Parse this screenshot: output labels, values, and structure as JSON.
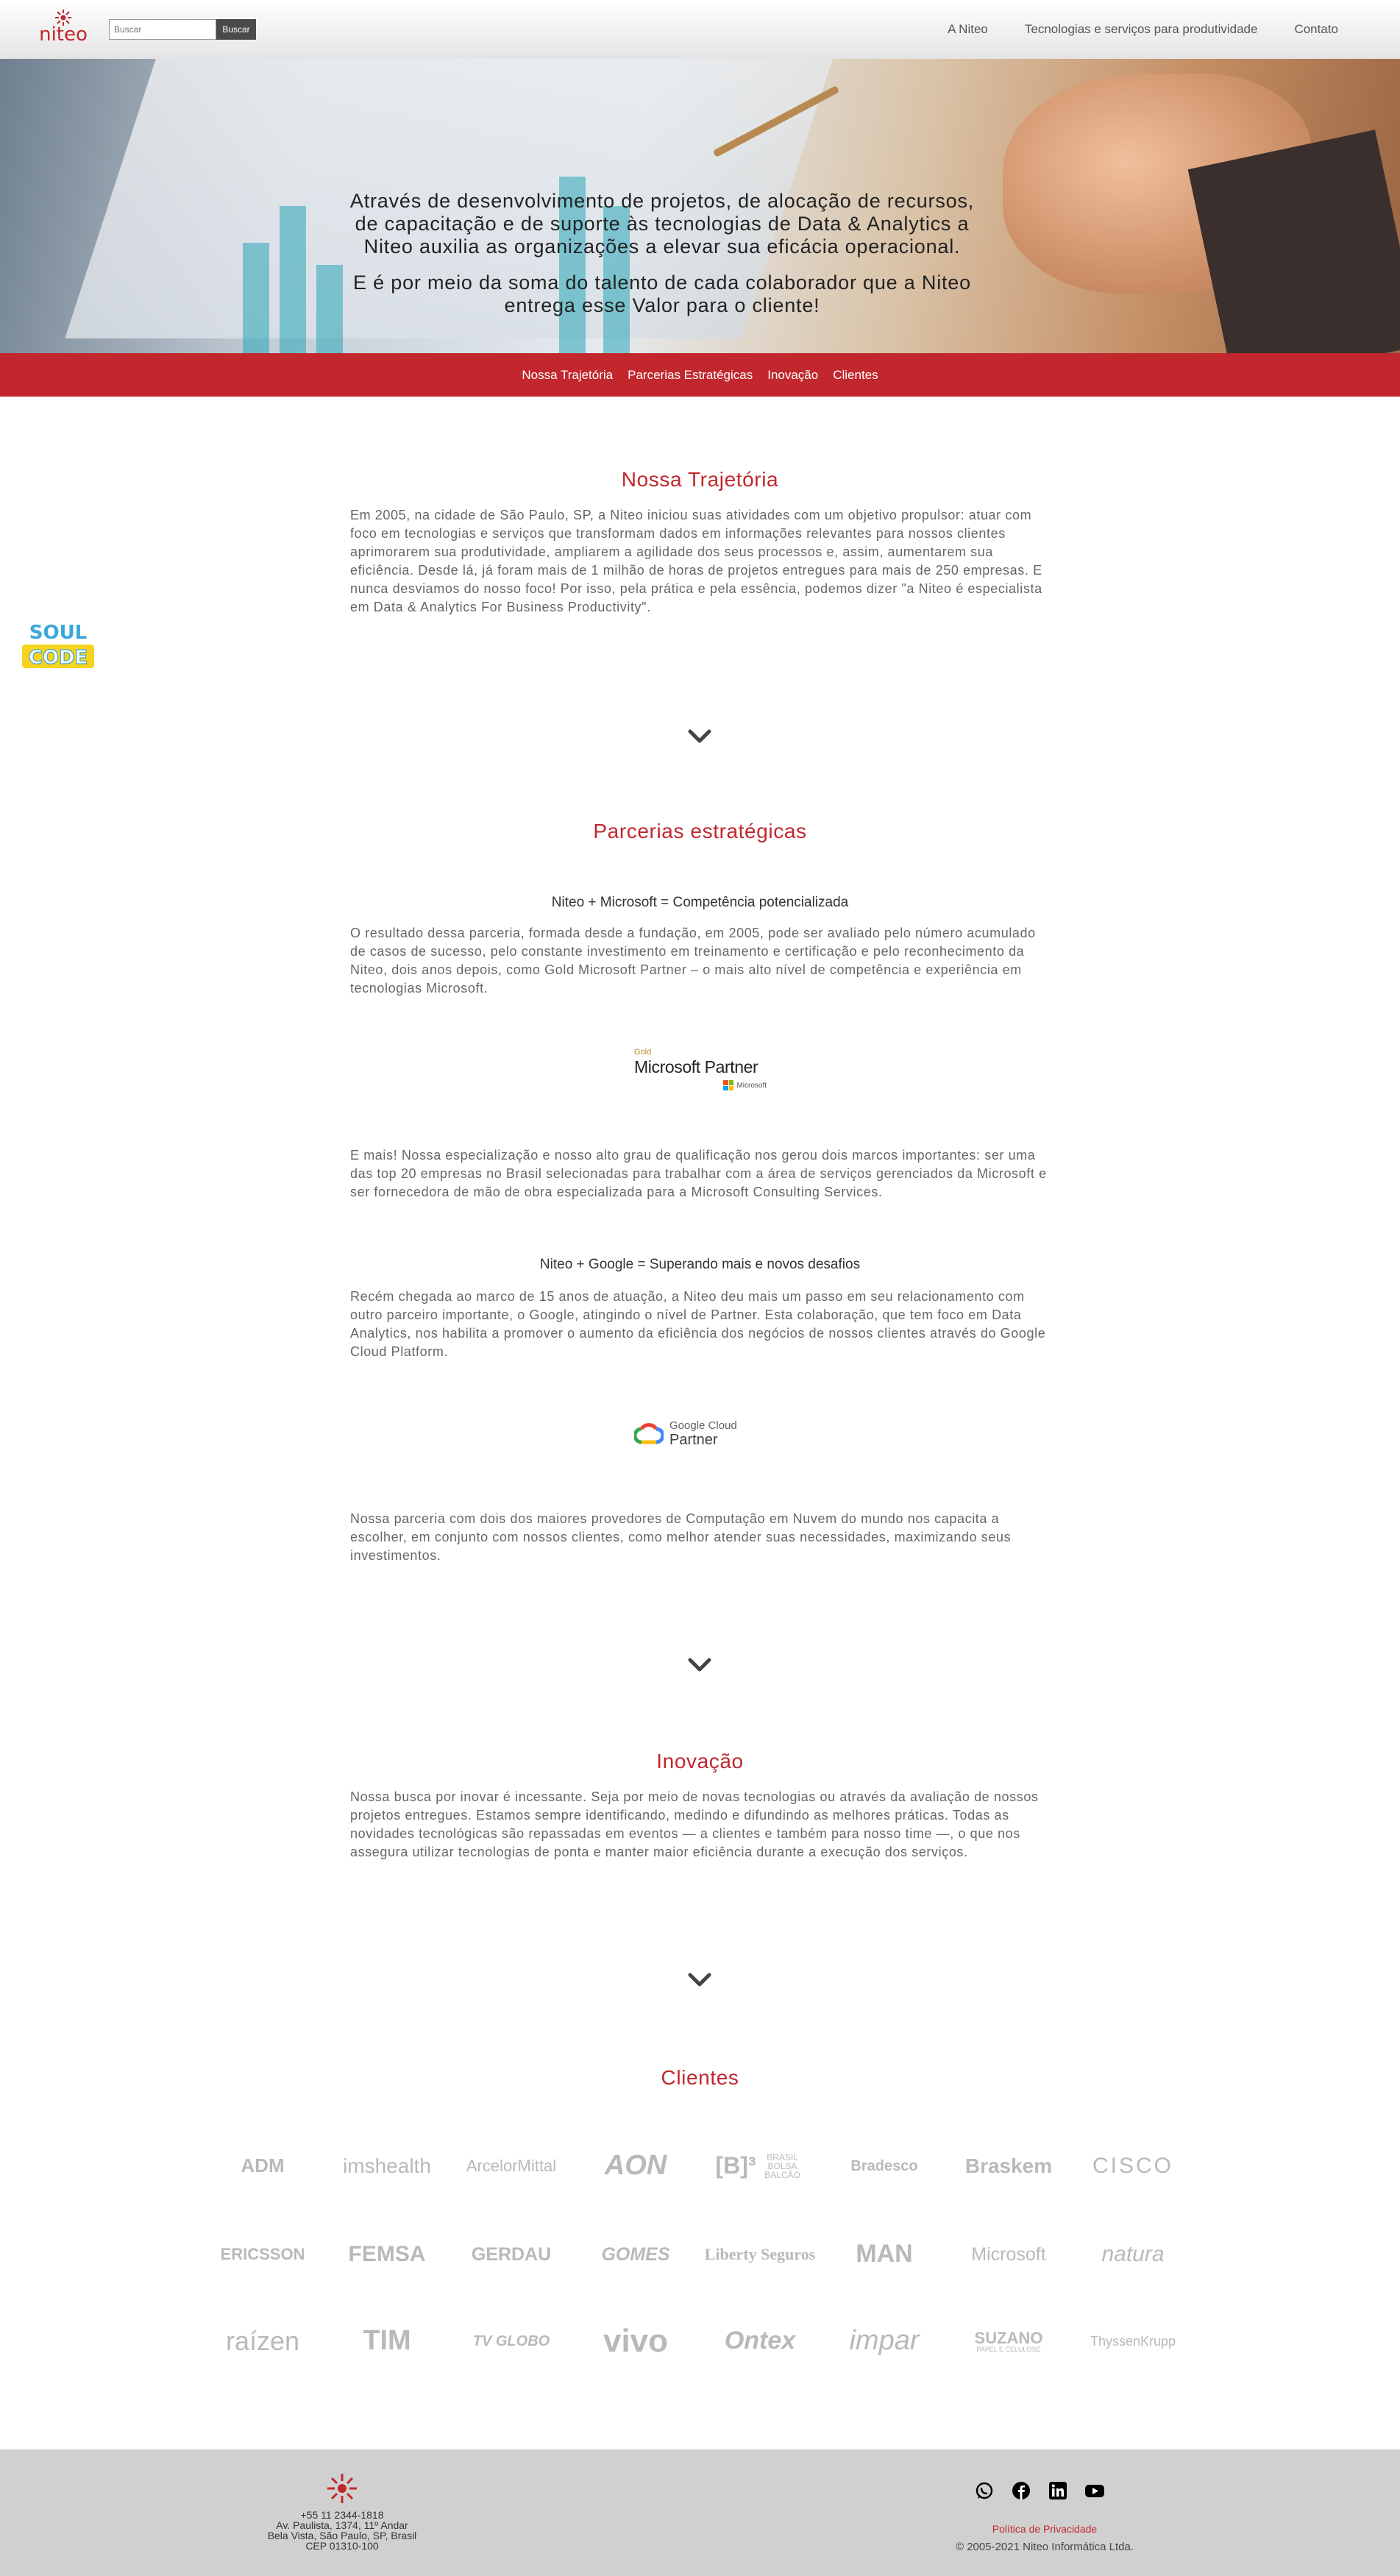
{
  "header": {
    "brand": "niteo",
    "search_placeholder": "Buscar",
    "search_button": "Buscar",
    "nav": [
      "A Niteo",
      "Tecnologias e serviços para produtividade",
      "Contato"
    ]
  },
  "hero": {
    "paragraph1": "Através de desenvolvimento de projetos, de alocação de recursos, de capacitação e de suporte às tecnologias de Data & Analytics a Niteo auxilia as organizações a elevar sua eficácia operacional.",
    "paragraph2": "E é por meio da soma do talento de cada colaborador que a Niteo entrega esse Valor para o cliente!"
  },
  "subnav": [
    "Nossa Trajetória",
    "Parcerias Estratégicas",
    "Inovação",
    "Clientes"
  ],
  "badge": {
    "line1": "SOUL",
    "line2": "CODE"
  },
  "trajetoria": {
    "title": "Nossa Trajetória",
    "text": "Em 2005, na cidade de São Paulo, SP, a Niteo iniciou suas atividades com um objetivo propulsor: atuar com foco em tecnologias e serviços que transformam dados em informações relevantes para nossos clientes aprimorarem sua produtividade, ampliarem a agilidade dos seus processos e, assim, aumentarem sua eficiência. Desde lá, já foram mais de 1 milhão de horas de projetos entregues para mais de 250 empresas. E nunca desviamos do nosso foco! Por isso, pela prática e pela essência, podemos dizer \"a Niteo é especialista em Data & Analytics For Business Productivity\"."
  },
  "parcerias": {
    "title": "Parcerias estratégicas",
    "ms_heading": "Niteo + Microsoft = Competência potencializada",
    "ms_text": "O resultado dessa parceria, formada desde a fundação, em 2005, pode ser avaliado pelo número acumulado de casos de sucesso, pelo constante investimento em treinamento e certificação e pelo reconhecimento da Niteo, dois anos depois, como Gold Microsoft Partner – o mais alto nível de competência e experiência em tecnologias Microsoft.",
    "ms_badge_gold": "Gold",
    "ms_badge_title": "Microsoft Partner",
    "ms_badge_small": "Microsoft",
    "ms_text2": "E mais! Nossa especialização e nosso alto grau de qualificação nos gerou dois marcos importantes: ser uma das top 20 empresas no Brasil selecionadas para trabalhar com a área de serviços gerenciados da Microsoft e ser fornecedora de mão de obra especializada para a Microsoft Consulting Services.",
    "google_heading": "Niteo + Google = Superando mais e novos desafios",
    "google_text": "Recém chegada ao marco de 15 anos de atuação, a Niteo deu mais um passo em seu relacionamento com outro parceiro importante, o Google, atingindo o nível de Partner. Esta colaboração, que tem foco em Data Analytics, nos habilita a promover o aumento da eficiência dos negócios de nossos clientes através do Google Cloud Platform.",
    "gc_line1": "Google Cloud",
    "gc_line2": "Partner",
    "closing_text": "Nossa parceria com dois dos maiores provedores de Computação em Nuvem do mundo nos capacita a escolher, em conjunto com nossos clientes, como melhor atender suas necessidades, maximizando seus investimentos."
  },
  "inovacao": {
    "title": "Inovação",
    "text": "Nossa busca por inovar é incessante. Seja por meio de novas tecnologias ou através da avaliação de nossos projetos entregues. Estamos sempre identificando, medindo e difundindo as melhores práticas. Todas as novidades tecnológicas são repassadas em eventos — a clientes e também para nosso time —, o que nos assegura utilizar tecnologias de ponta e manter maior eficiência durante a execução dos serviços."
  },
  "clientes": {
    "title": "Clientes",
    "logos": [
      "ADM",
      "imshealth",
      "ArcelorMittal",
      "AON",
      "[B]³",
      "Bradesco",
      "Braskem",
      "CISCO",
      "ERICSSON",
      "FEMSA",
      "GERDAU",
      "GOMES",
      "Liberty Seguros",
      "MAN",
      "Microsoft",
      "natura",
      "raízen",
      "TIM",
      "TV GLOBO",
      "vivo",
      "Ontex",
      "impar",
      "SUZANO",
      "ThyssenKrupp"
    ],
    "logo_subtexts": {
      "b3": "BRASIL BOLSA BALCÃO",
      "suzano": "PAPEL E CELULOSE"
    }
  },
  "footer": {
    "phone": "+55 11 2344-1818",
    "address1": "Av. Paulista, 1374, 11º Andar",
    "address2": "Bela Vista, São Paulo, SP, Brasil",
    "cep": "CEP 01310-100",
    "social": [
      "whatsapp",
      "facebook",
      "linkedin",
      "youtube"
    ],
    "privacy": "Política de Privacidade",
    "copyright": "© 2005-2021 Niteo Informática Ltda."
  },
  "colors": {
    "brand_red": "#c1272d",
    "footer_bg": "#d0d0d0",
    "logo_gray": "#b9b9b9"
  }
}
